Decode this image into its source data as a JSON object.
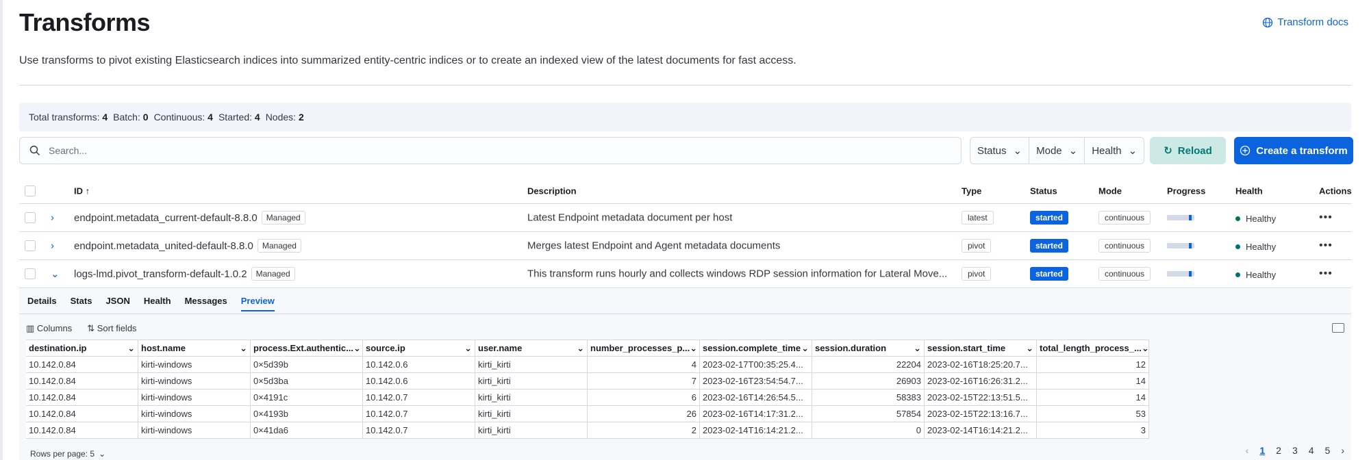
{
  "page": {
    "title": "Transforms",
    "docs_link": "Transform docs",
    "description": "Use transforms to pivot existing Elasticsearch indices into summarized entity-centric indices or to create an indexed view of the latest documents for fast access."
  },
  "stats": [
    {
      "label": "Total transforms:",
      "value": "4"
    },
    {
      "label": "Batch:",
      "value": "0"
    },
    {
      "label": "Continuous:",
      "value": "4"
    },
    {
      "label": "Started:",
      "value": "4"
    },
    {
      "label": "Nodes:",
      "value": "2"
    }
  ],
  "toolbar": {
    "search_placeholder": "Search...",
    "filters": [
      "Status",
      "Mode",
      "Health"
    ],
    "reload_label": "Reload",
    "create_label": "Create a transform"
  },
  "table": {
    "headers": {
      "id": "ID ↑",
      "description": "Description",
      "type": "Type",
      "status": "Status",
      "mode": "Mode",
      "progress": "Progress",
      "health": "Health",
      "actions": "Actions"
    },
    "rows": [
      {
        "id": "endpoint.metadata_current-default-8.8.0",
        "badge": "Managed",
        "description": "Latest Endpoint metadata document per host",
        "type": "latest",
        "status": "started",
        "mode": "continuous",
        "progress": 0.9,
        "health": "Healthy",
        "expanded": false
      },
      {
        "id": "endpoint.metadata_united-default-8.8.0",
        "badge": "Managed",
        "description": "Merges latest Endpoint and Agent metadata documents",
        "type": "pivot",
        "status": "started",
        "mode": "continuous",
        "progress": 0.9,
        "health": "Healthy",
        "expanded": false
      },
      {
        "id": "logs-lmd.pivot_transform-default-1.0.2",
        "badge": "Managed",
        "description": "This transform runs hourly and collects windows RDP session information for Lateral Move...",
        "type": "pivot",
        "status": "started",
        "mode": "continuous",
        "progress": 0.9,
        "health": "Healthy",
        "expanded": true
      }
    ]
  },
  "details": {
    "tabs": [
      "Details",
      "Stats",
      "JSON",
      "Health",
      "Messages",
      "Preview"
    ],
    "active_tab": "Preview",
    "columns_label": "Columns",
    "sort_label": "Sort fields",
    "grid_headers": [
      "destination.ip",
      "host.name",
      "process.Ext.authentic...",
      "source.ip",
      "user.name",
      "number_processes_p...",
      "session.complete_time",
      "session.duration",
      "session.start_time",
      "total_length_process_..."
    ],
    "grid_rows": [
      [
        "10.142.0.84",
        "kirti-windows",
        "0×5d39b",
        "10.142.0.6",
        "kirti_kirti",
        "4",
        "2023-02-17T00:35:25.4...",
        "22204",
        "2023-02-16T18:25:20.7...",
        "12"
      ],
      [
        "10.142.0.84",
        "kirti-windows",
        "0×5d3ba",
        "10.142.0.6",
        "kirti_kirti",
        "7",
        "2023-02-16T23:54:54.7...",
        "26903",
        "2023-02-16T16:26:31.2...",
        "14"
      ],
      [
        "10.142.0.84",
        "kirti-windows",
        "0×4191c",
        "10.142.0.7",
        "kirti_kirti",
        "6",
        "2023-02-16T14:26:54.5...",
        "58383",
        "2023-02-15T22:13:51.5...",
        "14"
      ],
      [
        "10.142.0.84",
        "kirti-windows",
        "0×4193b",
        "10.142.0.7",
        "kirti_kirti",
        "26",
        "2023-02-16T14:17:31.2...",
        "57854",
        "2023-02-15T22:13:16.7...",
        "53"
      ],
      [
        "10.142.0.84",
        "kirti-windows",
        "0×41da6",
        "10.142.0.7",
        "kirti_kirti",
        "2",
        "2023-02-14T16:14:21.2...",
        "0",
        "2023-02-14T16:14:21.2...",
        "3"
      ]
    ],
    "rows_per_page": "Rows per page: 5",
    "pages": [
      "1",
      "2",
      "3",
      "4",
      "5"
    ],
    "current_page": "1"
  },
  "colors": {
    "accent": "#0b64dd",
    "success": "#00726b",
    "reload_bg": "#cde9e6"
  }
}
